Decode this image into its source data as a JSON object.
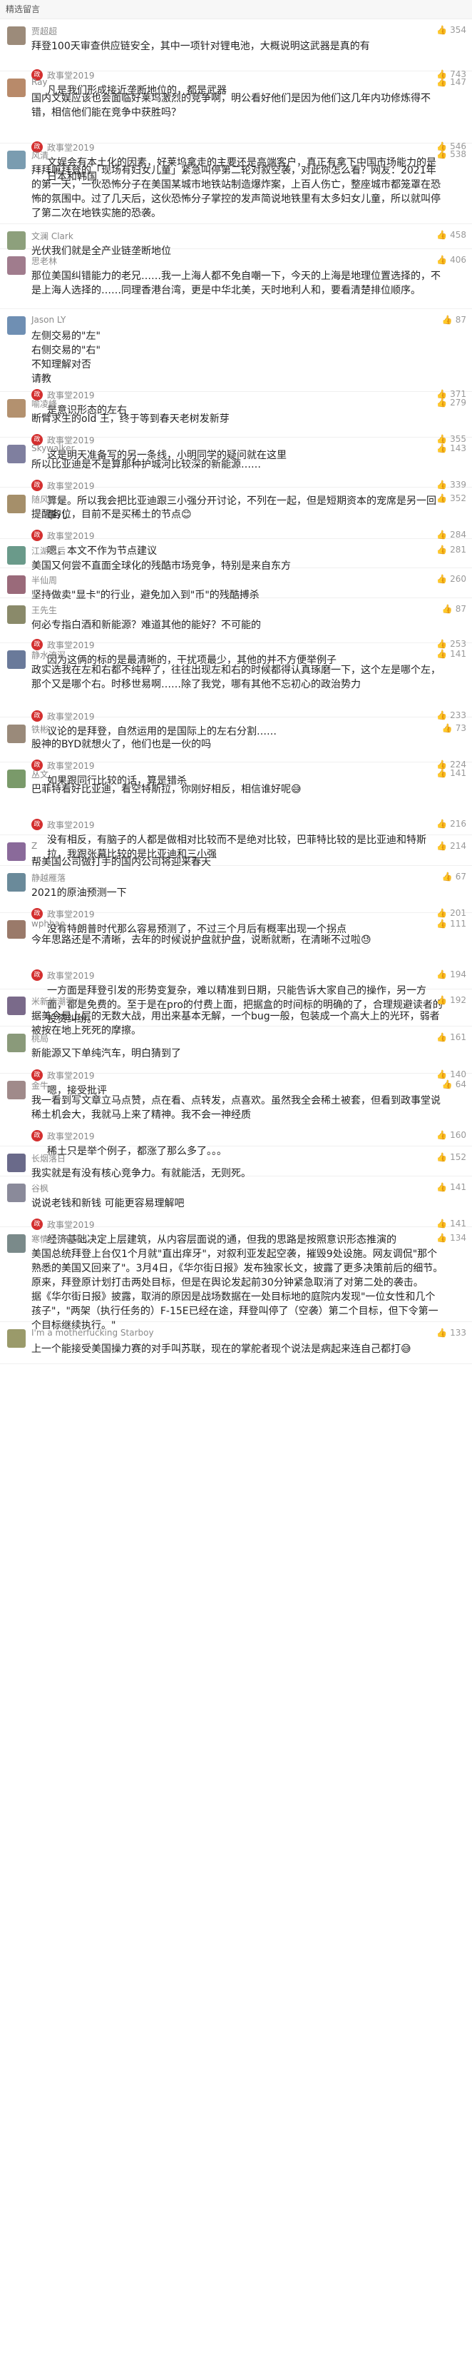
{
  "header": "精选留言",
  "reply_badge": "政",
  "comments": [
    {
      "name": "贾超超",
      "likes": "354",
      "text": "拜登100天审查供应链安全，其中一项针对锂电池，大概说明这武器是真的有",
      "reply": {
        "name": "政事堂2019",
        "likes": "743",
        "text": "凡是我们形成接近垄断地位的，都是武器"
      }
    },
    {
      "name": "Ray",
      "likes": "147",
      "text": "国内文娱应该也会面临好莱坞激烈的竞争啊，明公看好他们是因为他们这几年内功修炼得不错，相信他们能在竞争中获胜吗？",
      "reply": {
        "name": "政事堂2019",
        "likes": "546",
        "text": "文娱会有本土化的因素，好莱坞拿走的主要还是高端客户，真正有拿下中国市场能力的是日本和韩国"
      }
    },
    {
      "name": "风清",
      "likes": "538",
      "text": "拜拜嘛拜登的「现场有妇女儿童」紧急叫停第二轮对叙空袭，对此你怎么看？网友：2021年的第一天，一伙恐怖分子在美国某城市地铁站制造爆炸案，上百人伤亡，整座城市都笼罩在恐怖的氛围中。过了几天后，这伙恐怖分子掌控的发声简说地铁里有太多妇女儿童，所以就叫停了第二次在地铁实施的恐袭。"
    },
    {
      "name": "文澜 Clark",
      "likes": "458",
      "text": "光伏我们就是全产业链垄断地位"
    },
    {
      "name": "思老林",
      "likes": "406",
      "text": "那位美国纠错能力的老兄……我一上海人都不免自嘲一下，今天的上海是地理位置选择的，不是上海人选择的……同理香港台湾，更是中华北美，天时地利人和，要看清楚排位顺序。"
    },
    {
      "name": "Jason LY",
      "likes": "87",
      "text": "左侧交易的\"左\"\n右侧交易的\"右\"\n不知理解对否\n请教",
      "reply": {
        "name": "政事堂2019",
        "likes": "371",
        "text": "是意识形态的左右"
      }
    },
    {
      "name": "喻凌峰",
      "likes": "279",
      "text": "断臂求生的old 王，终于等到春天老树发新芽",
      "reply": {
        "name": "政事堂2019",
        "likes": "355",
        "text": "这是明天准备写的另一条线，小明同学的疑问就在这里"
      }
    },
    {
      "name": "Skywalker",
      "likes": "143",
      "text": "所以比亚迪是不是算那种护城河比较深的新能源……",
      "reply": {
        "name": "政事堂2019",
        "likes": "339",
        "text": "算是。所以我会把比亚迪跟三小强分开讨论，不列在一起，但是短期资本的宠席是另一回事儿"
      }
    },
    {
      "name": "随风行健",
      "likes": "352",
      "text": "提醒各位，目前不是买稀土的节点😊",
      "reply": {
        "name": "政事堂2019",
        "likes": "284",
        "text": "嗯，本文不作为节点建议"
      }
    },
    {
      "name": "江湖之后",
      "likes": "281",
      "text": "美国又何尝不直面全球化的残酷市场竞争，特别是来自东方"
    },
    {
      "name": "半仙周",
      "likes": "260",
      "text": "坚持做卖\"显卡\"的行业，避免加入到\"币\"的残酷搏杀"
    },
    {
      "name": "王先生",
      "likes": "87",
      "text": "何必专指白酒和新能源？难道其他的能好？不可能的",
      "reply": {
        "name": "政事堂2019",
        "likes": "253",
        "text": "因为这俩的标的是最清晰的，干扰项最少，其他的并不方便举例子"
      }
    },
    {
      "name": "静水流深",
      "likes": "141",
      "text": "政实选我在左和右都不纯粹了，往往出现左和右的时候都得认真琢磨一下，这个左是哪个左，那个又是哪个右。时移世易啊……除了我党，哪有其他不忘初心的政治势力",
      "reply": {
        "name": "政事堂2019",
        "likes": "233",
        "text": "议论的是拜登，自然运用的是国际上的左右分割……"
      }
    },
    {
      "name": "铁彬",
      "likes": "73",
      "text": "股神的BYD就想火了，他们也是一伙的吗",
      "reply": {
        "name": "政事堂2019",
        "likes": "224",
        "text": "如果跟同行比较的话，算是错杀"
      }
    },
    {
      "name": "丛文",
      "likes": "141",
      "text": "巴菲特看好比亚迪，看空特斯拉，你刚好相反，相信谁好呢😅",
      "reply": {
        "name": "政事堂2019",
        "likes": "216",
        "text": "没有相反，有脑子的人都是做相对比较而不是绝对比较，巴菲特比较的是比亚迪和特斯拉，我跟张幕比较的是比亚迪和三小强"
      }
    },
    {
      "name": "Z",
      "likes": "214",
      "text": "帮美国公司做打手的国内公司将迎来春天"
    },
    {
      "name": "静越雁落",
      "likes": "67",
      "text": "2021的原油预测一下",
      "reply": {
        "name": "政事堂2019",
        "likes": "201",
        "text": "没有特朗普时代那么容易预测了，不过三个月后有概率出现一个拐点"
      }
    },
    {
      "name": "wphhao",
      "likes": "111",
      "text": "今年思路还是不清晰，去年的时候说护盘就护盘，说断就断，在清晰不过啦😓",
      "reply": {
        "name": "政事堂2019",
        "likes": "194",
        "text": "一方面是拜登引发的形势变复杂，难以精准到日期，只能告诉大家自己的操作，另一方面，都是免费的。至于是在pro的付费上面，把据盒的时间标的明确的了，合理规避读者的投资纠纷。"
      }
    },
    {
      "name": "米新炸潮零八",
      "likes": "192",
      "text": "据美今是上层的无数大战，用出来基本无解，一个bug一般，包装成一个高大上的光环，弱者被按在地上死死的摩擦。"
    },
    {
      "name": "桃局",
      "likes": "161",
      "text": "新能源又下单纯汽车，明白猜到了",
      "reply": {
        "name": "政事堂2019",
        "likes": "140",
        "text": "嗯，接受批评"
      }
    },
    {
      "name": "金牛",
      "likes": "64",
      "text": "我一看到写文章立马点赞，点在看、点转发，点喜欢。虽然我全会稀土被套，但看到政事堂说稀土机会大，我就马上来了精神。我不会一神经质",
      "reply": {
        "name": "政事堂2019",
        "likes": "160",
        "text": "稀土只是举个例子，都涨了那么多了。。。"
      }
    },
    {
      "name": "长烟落日",
      "likes": "152",
      "text": "我实就是有没有核心竞争力。有就能活，无则死。"
    },
    {
      "name": "谷枫",
      "likes": "141",
      "text": "说说老钱和新钱 可能更容易理解吧",
      "reply": {
        "name": "政事堂2019",
        "likes": "141",
        "text": "经济基础决定上层建筑，从内容层面说的通，但我的思路是按照意识形态推演的"
      }
    },
    {
      "name": "寒情绘夜稿事...",
      "likes": "134",
      "text": "美国总统拜登上台仅1个月就\"直出痒牙\"，对叙利亚发起空袭，摧毁9处设施。网友调侃\"那个熟悉的美国又回来了\"。3月4日，《华尔街日报》发布独家长文，披露了更多决策前后的细节。原来，拜登原计划打击两处目标，但是在舆论发起前30分钟紧急取消了对第二处的袭击。\n据《华尔街日报》披露，取消的原因是战场数据在一处目标地的庭院内发现\"一位女性和几个孩子\"，\"两架（执行任务的）F-15E已经在途，拜登叫停了（空袭）第二个目标，但下令第一个目标继续执行。\""
    },
    {
      "name": "I'm a motherfucking Starboy",
      "likes": "133",
      "text": "上一个能接受美国操力赛的对手叫苏联，现在的掌舵者现个说法是病起来连自己都打😅"
    }
  ]
}
